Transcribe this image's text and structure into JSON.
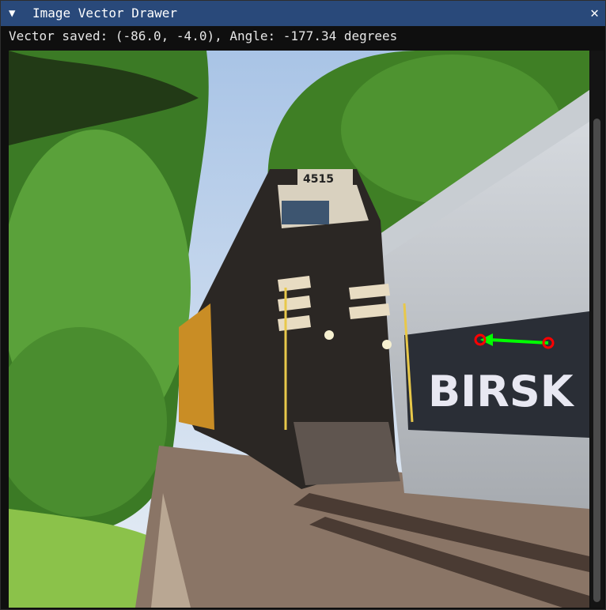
{
  "window": {
    "title": "Image Vector Drawer",
    "collapse_icon": "triangle-down-icon",
    "close_icon": "close-icon"
  },
  "status": {
    "text": "Vector saved: (-86.0, -4.0), Angle: -177.34 degrees"
  },
  "image": {
    "locomotive_number": "4515",
    "graffiti_text": "BIRSK"
  },
  "vector": {
    "dx": -86.0,
    "dy": -4.0,
    "angle_degrees": -177.34,
    "arrow_color": "#00ff00",
    "endpoint_color": "#ff0000"
  },
  "colors": {
    "titlebar": "#29497a",
    "background": "#0f0f0f",
    "text": "#e6e6e6"
  }
}
